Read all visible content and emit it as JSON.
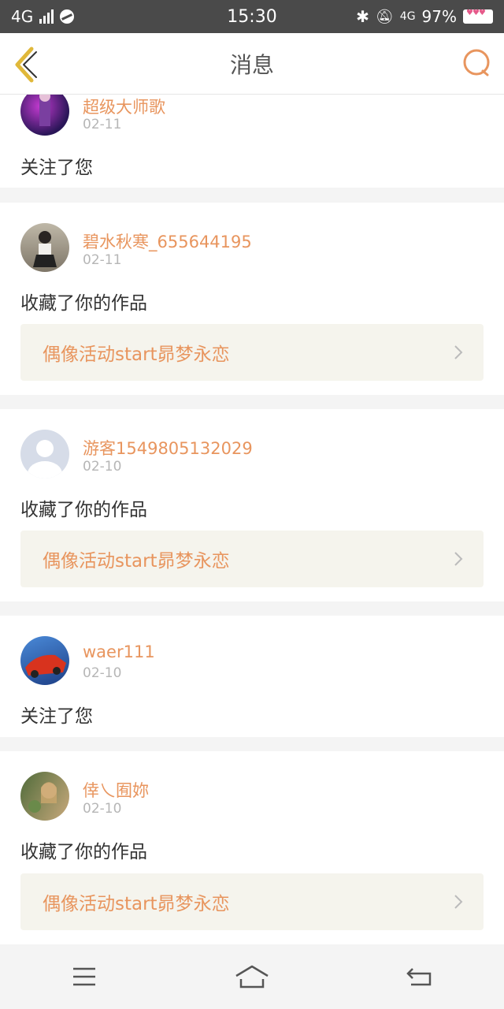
{
  "status_bar": {
    "network": "4G",
    "time": "15:30",
    "network_right": "4G",
    "battery": "97%"
  },
  "header": {
    "title": "消息"
  },
  "messages": [
    {
      "username": "超级大师歌",
      "date": "02-11",
      "action": "关注了您"
    },
    {
      "username": "碧水秋寒_655644195",
      "date": "02-11",
      "action": "收藏了你的作品",
      "work_title": "偶像活动start昴梦永恋"
    },
    {
      "username": "游客1549805132029",
      "date": "02-10",
      "action": "收藏了你的作品",
      "work_title": "偶像活动start昴梦永恋"
    },
    {
      "username": "waer111",
      "date": "02-10",
      "action": "关注了您"
    },
    {
      "username": "倖乀囿妳",
      "date": "02-10",
      "action": "收藏了你的作品",
      "work_title": "偶像活动start昴梦永恋"
    }
  ],
  "colors": {
    "accent": "#e8955e",
    "back_arrow": "#e0b83a"
  }
}
